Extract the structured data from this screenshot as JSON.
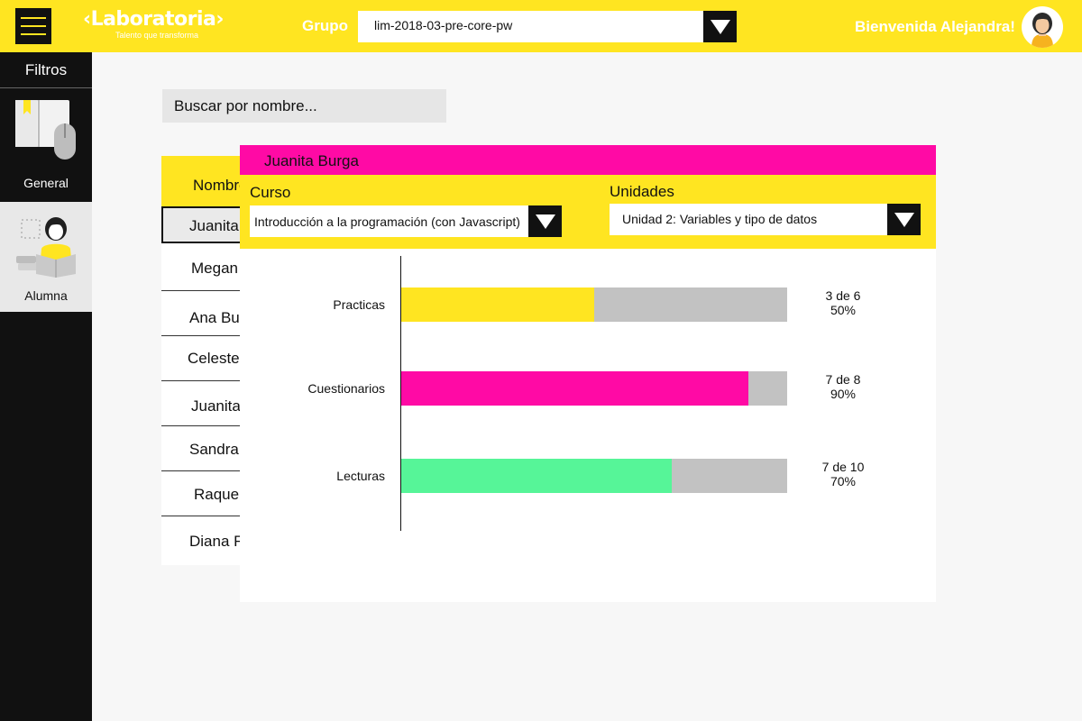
{
  "topbar": {
    "brand": "‹Laboratoria›",
    "tagline": "Talento que transforma",
    "grupo_label": "Grupo",
    "grupo_value": "lim-2018-03-pre-core-pw",
    "welcome": "Bienvenida Alejandra!"
  },
  "sidebar": {
    "title": "Filtros",
    "items": [
      {
        "label": "General"
      },
      {
        "label": "Alumna"
      }
    ]
  },
  "search": {
    "placeholder": "Buscar por nombre..."
  },
  "list": {
    "header": "Nombre",
    "rows": [
      "Juanita",
      "Megan",
      "Ana Bu",
      "Celeste",
      "Juanita",
      "Sandra",
      "Raque",
      "Diana F"
    ]
  },
  "panel": {
    "student_name": "Juanita Burga",
    "curso_label": "Curso",
    "curso_value": "Introducción a la programación (con Javascript)",
    "unidades_label": "Unidades",
    "unidades_value": "Unidad 2: Variables y tipo de datos"
  },
  "colors": {
    "yellow": "#ffe521",
    "magenta": "#ff0aa5",
    "green": "#56f598",
    "track": "#c2c2c2"
  },
  "chart_data": {
    "type": "bar",
    "orientation": "horizontal",
    "categories": [
      "Practicas",
      "Cuestionarios",
      "Lecturas"
    ],
    "values": [
      50,
      90,
      70
    ],
    "counts": [
      "3 de 6",
      "7 de 8",
      "7 de 10"
    ],
    "percent_labels": [
      "50%",
      "90%",
      "70%"
    ],
    "bar_colors": [
      "#ffe521",
      "#ff0aa5",
      "#56f598"
    ],
    "xlim": [
      0,
      100
    ]
  }
}
